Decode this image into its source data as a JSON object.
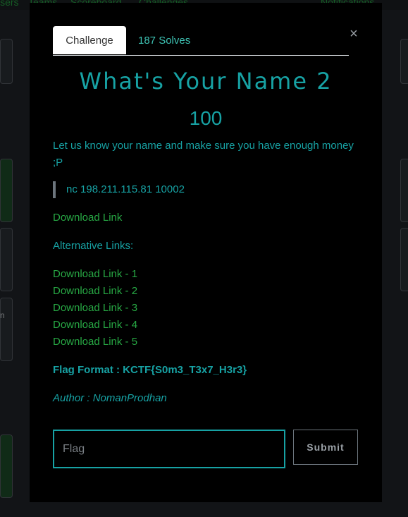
{
  "background": {
    "nav_items": [
      "Users",
      "Teams",
      "Scoreboard",
      "Challenges"
    ],
    "notifications_label": "Notifications",
    "card_fragment": "n"
  },
  "modal": {
    "tabs": [
      {
        "label": "Challenge"
      },
      {
        "label": "187 Solves"
      }
    ],
    "close_icon": "×",
    "title": "What's Your Name 2",
    "value": "100",
    "description": "Let us know your name and make sure you have enough money ;P",
    "connection": "nc 198.211.115.81 10002",
    "download_link": "Download Link",
    "alternative_heading": "Alternative Links:",
    "alternative_links": [
      "Download Link - 1",
      "Download Link - 2",
      "Download Link - 3",
      "Download Link - 4",
      "Download Link - 5"
    ],
    "flag_format": "Flag Format : KCTF{S0m3_T3x7_H3r3}",
    "author": "Author : NomanProdhan",
    "flag_placeholder": "Flag",
    "submit_label": "Submit"
  },
  "colors": {
    "accent": "#17a2a4",
    "link": "#27a844",
    "modal_bg": "#000000"
  }
}
